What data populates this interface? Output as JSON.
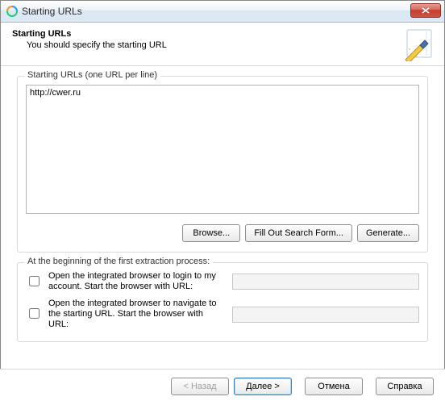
{
  "window": {
    "title": "Starting URLs"
  },
  "header": {
    "title": "Starting URLs",
    "subtitle": "You should specify the starting URL"
  },
  "group1": {
    "legend": "Starting URLs (one URL per line)",
    "textarea_value": "http://cwer.ru",
    "buttons": {
      "browse": "Browse...",
      "fillout": "Fill Out Search Form...",
      "generate": "Generate..."
    }
  },
  "group2": {
    "legend": "At the beginning of the first extraction process:",
    "opt_login_label": "Open the integrated browser to login to my account. Start the browser with URL:",
    "opt_login_value": "",
    "opt_nav_label": "Open the integrated browser to navigate to the starting URL. Start the browser with URL:",
    "opt_nav_value": ""
  },
  "footer": {
    "back": "< Назад",
    "next": "Далее >",
    "cancel": "Отмена",
    "help": "Справка"
  }
}
